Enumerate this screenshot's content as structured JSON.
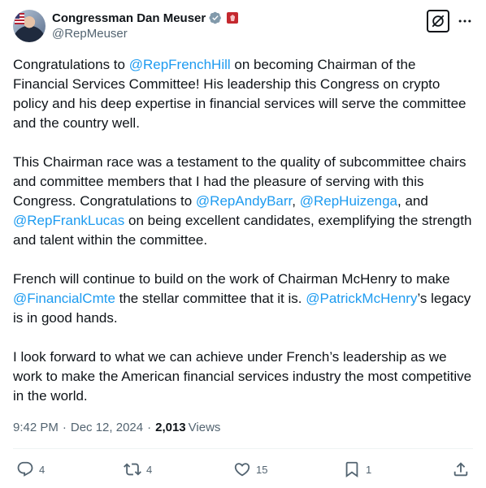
{
  "author": {
    "display_name": "Congressman Dan Meuser",
    "handle": "@RepMeuser"
  },
  "tweet": {
    "p1_a": "Congratulations to ",
    "p1_mention": "@RepFrenchHill",
    "p1_b": " on becoming Chairman of the Financial Services Committee! His leadership this Congress on crypto policy and his deep expertise in financial services will serve the committee and the country well.",
    "p2_a": "This Chairman race was a testament to the quality of subcommittee chairs and committee members that I had the pleasure of serving with this Congress. Congratulations to ",
    "p2_m1": "@RepAndyBarr",
    "p2_sep1": ", ",
    "p2_m2": "@RepHuizenga",
    "p2_sep2": ", and ",
    "p2_m3": "@RepFrankLucas",
    "p2_b": " on being excellent candidates, exemplifying the strength and talent within the committee.",
    "p3_a": "French will continue to build on the work of Chairman McHenry to make ",
    "p3_m1": "@FinancialCmte",
    "p3_b": " the stellar committee that it is. ",
    "p3_m2": "@PatrickMcHenry",
    "p3_c": "’s legacy is in good hands.",
    "p4": "I look forward to what we can achieve under French’s leadership as we work to make the American financial services industry the most competitive in the world."
  },
  "meta": {
    "time": "9:42 PM",
    "dot": "·",
    "date": "Dec 12, 2024",
    "views_count": "2,013",
    "views_label": "Views"
  },
  "actions": {
    "replies": "4",
    "reposts": "4",
    "likes": "15",
    "bookmarks": "1"
  },
  "icons": {
    "verified": "verified-badge-icon",
    "government": "government-label-icon",
    "grok": "grok-icon",
    "more": "more-icon",
    "reply": "reply-icon",
    "repost": "repost-icon",
    "like": "like-icon",
    "bookmark": "bookmark-icon",
    "share": "share-icon"
  },
  "colors": {
    "link": "#1d9bf0",
    "text": "#0f1419",
    "secondary": "#536471",
    "verified": "#829aab",
    "gov_badge": "#c4282e"
  }
}
